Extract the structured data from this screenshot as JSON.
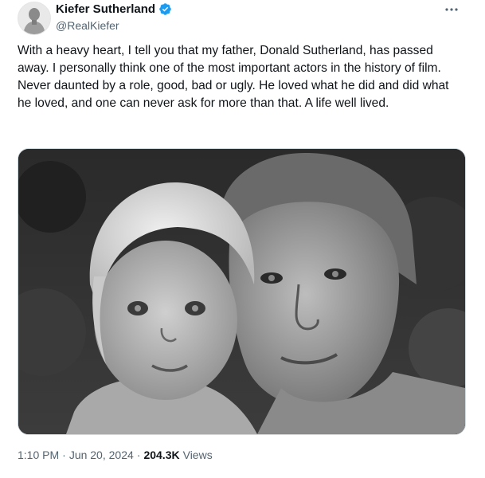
{
  "author": {
    "display_name": "Kiefer Sutherland",
    "handle": "@RealKiefer",
    "verified_color": "#1d9bf0"
  },
  "tweet": {
    "text": "With a heavy heart, I tell you that my father, Donald Sutherland, has passed away. I personally think one of the most important actors in the history of film. Never daunted by a role, good, bad or ugly. He loved what he did and did what he loved, and one can never ask for more than that. A life well lived.",
    "time": "1:10 PM",
    "date": "Jun 20, 2024",
    "separator": "·",
    "views_count": "204.3K",
    "views_label": "Views"
  },
  "icons": {
    "verified": "verified-badge-icon",
    "more": "more-options-icon"
  },
  "colors": {
    "text": "#0f1419",
    "secondary": "#536471",
    "border": "#cfd9de"
  }
}
